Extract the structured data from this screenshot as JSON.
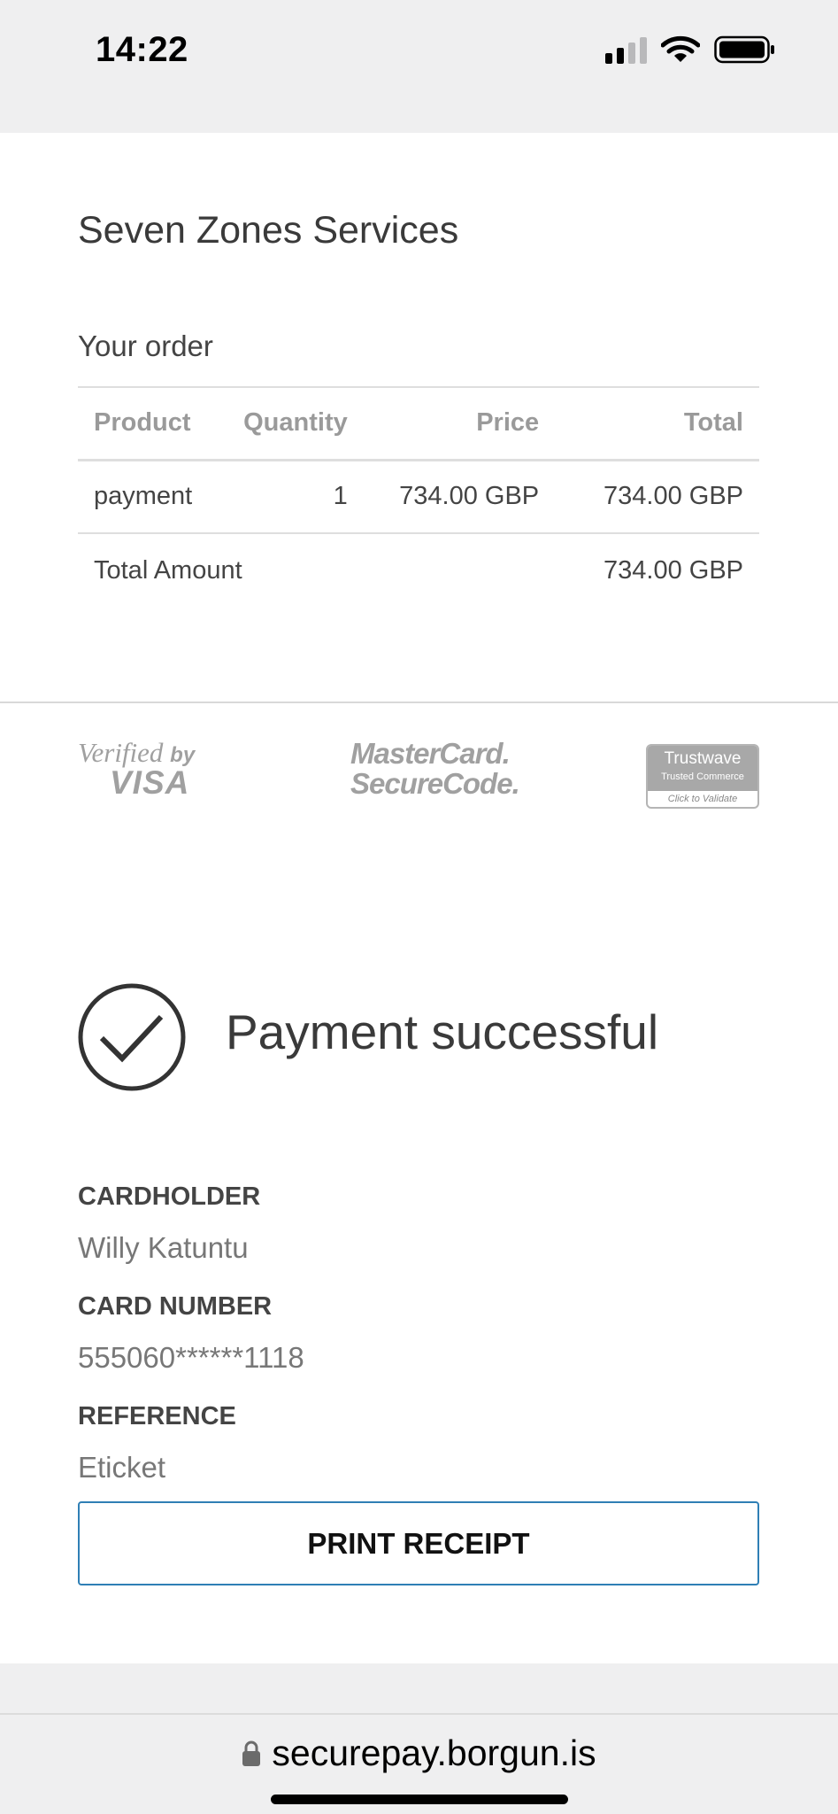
{
  "status_bar": {
    "time": "14:22",
    "signal_icon": "cellular-signal-icon",
    "wifi_icon": "wifi-icon",
    "battery_icon": "battery-icon"
  },
  "merchant_name": "Seven Zones Services",
  "order": {
    "title": "Your order",
    "columns": {
      "product": "Product",
      "quantity": "Quantity",
      "price": "Price",
      "total": "Total"
    },
    "item": {
      "product": "payment",
      "quantity": "1",
      "price": "734.00 GBP",
      "total": "734.00 GBP"
    },
    "total_label": "Total Amount",
    "total_value": "734.00 GBP"
  },
  "security_logos": {
    "visa": {
      "line1": "Verified",
      "line1b": "by",
      "line2": "VISA"
    },
    "mastercard": {
      "line1": "MasterCard.",
      "line2": "SecureCode."
    },
    "trustwave": {
      "brand": "Trustwave",
      "sub": "Trusted Commerce",
      "validate": "Click to Validate"
    }
  },
  "result": {
    "icon": "checkmark-circle-icon",
    "message": "Payment successful"
  },
  "details": {
    "cardholder_label": "CARDHOLDER",
    "cardholder_value": "Willy Katuntu",
    "card_number_label": "CARD NUMBER",
    "card_number_value": "555060******1118",
    "reference_label": "REFERENCE",
    "reference_value": "Eticket"
  },
  "print_button": "PRINT RECEIPT",
  "browser": {
    "url": "securepay.borgun.is",
    "lock_icon": "lock-icon"
  },
  "colors": {
    "button_border": "#2f7fb5",
    "text_dark": "#3a3a3a",
    "text_muted": "#777777",
    "logo_grey": "#a0a0a0"
  }
}
